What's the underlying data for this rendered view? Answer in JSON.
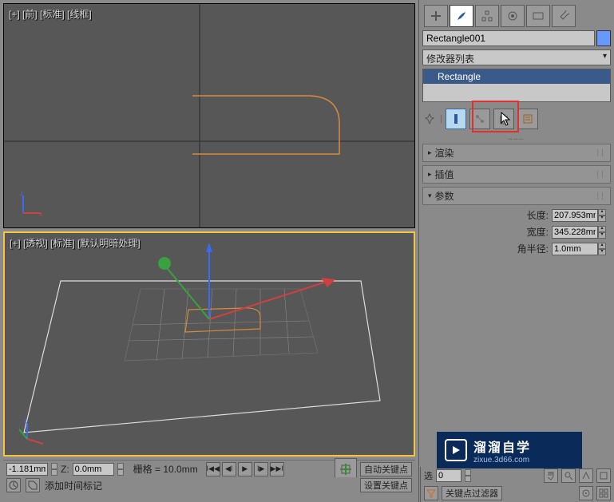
{
  "viewports": {
    "top": {
      "label": "[+] [前] [标准] [线框]"
    },
    "bottom": {
      "label": "[+] [透视] [标准] [默认明暗处理]"
    }
  },
  "right_panel": {
    "object_name": "Rectangle001",
    "modifier_list_label": "修改器列表",
    "stack_item": "Rectangle",
    "rollouts": {
      "render": {
        "title": "渲染"
      },
      "interp": {
        "title": "插值"
      },
      "params": {
        "title": "参数",
        "length_label": "长度:",
        "length_value": "207.953mm",
        "width_label": "宽度:",
        "width_value": "345.228mm",
        "corner_radius_label": "角半径:",
        "corner_radius_value": "1.0mm"
      }
    }
  },
  "bottom": {
    "x_value": "-1.181mm",
    "z_label": "Z:",
    "z_value": "0.0mm",
    "grid_text": "栅格 = 10.0mm",
    "auto_key": "自动关键点",
    "sel_lock": "选",
    "add_time_tag": "添加时间标记",
    "set_key": "设置关键点",
    "key_filter": "关键点过滤器",
    "frame": "0"
  },
  "watermark": {
    "title": "溜溜自学",
    "url": "zixue.3d66.com"
  }
}
